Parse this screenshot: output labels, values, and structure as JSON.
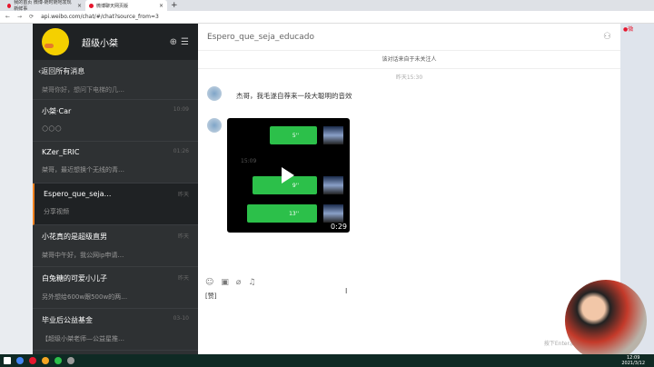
{
  "browser": {
    "tabs": [
      {
        "title": "我的首页 微博-随时随地发现新鲜事"
      },
      {
        "title": "微博聊天网页版"
      }
    ],
    "url": "api.weibo.com/chat/#/chat?source_from=3"
  },
  "sidebar": {
    "username": "超级小桀",
    "back_label": "返回所有消息",
    "partial_preview": "桀哥你好，想问下电梯的几…",
    "items": [
      {
        "name": "小桀·Car",
        "time": "10:09",
        "preview": "🌕🌕🌕"
      },
      {
        "name": "KZer_ERIC",
        "time": "01:26",
        "preview": "桀哥，最近想换个无线的青…"
      },
      {
        "name": "Espero_que_seja…",
        "time": "昨天",
        "preview": "分享视频"
      },
      {
        "name": "小花真的是超级直男",
        "time": "昨天",
        "preview": "桀哥中午好，我公网ip申请…"
      },
      {
        "name": "白兔糖的可爱小儿子",
        "time": "昨天",
        "preview": "另外想给600w跟500w的两…"
      },
      {
        "name": "毕业后公益基金",
        "time": "03-10",
        "preview": "【超级小桀老师—公益星推…"
      }
    ]
  },
  "chat": {
    "title": "Espero_que_seja_educado",
    "notice": "该对话来自于未关注人",
    "timestamp": "昨天15:30",
    "message": "杰哥，我毛遂自荐来一段大聪明的音效",
    "video": {
      "time_label": "15:09",
      "voices": [
        "5''",
        "9''",
        "13''"
      ],
      "duration": "0:29"
    },
    "input_value": "[赞]",
    "hint": "按下Enter发送内容/"
  },
  "taskbar": {
    "time": "12:09",
    "date": "2021/3/12"
  }
}
